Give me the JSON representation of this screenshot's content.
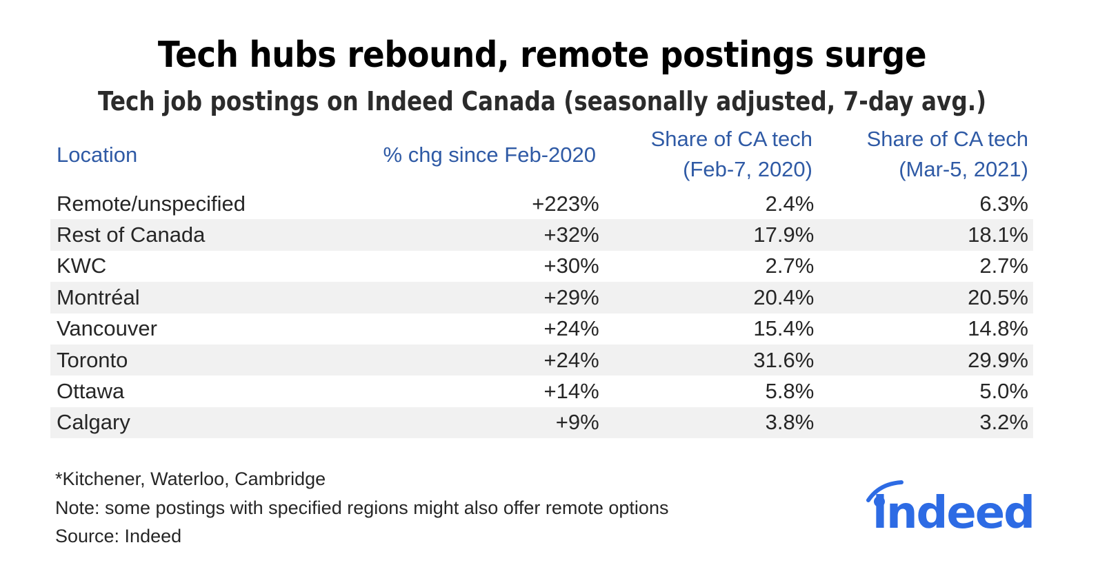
{
  "title": "Tech hubs rebound, remote postings surge",
  "subtitle": "Tech job postings on Indeed Canada (seasonally adjusted, 7-day avg.)",
  "colors": {
    "header_text": "#2f5aa5",
    "stripe": "#f1f1f1",
    "logo": "#2d6be4"
  },
  "chart_data": {
    "type": "table",
    "title": "Tech hubs rebound, remote postings surge",
    "subtitle": "Tech job postings on Indeed Canada (seasonally adjusted, 7-day avg.)",
    "columns": [
      "Location",
      "% chg since Feb-2020",
      "Share of CA tech (Feb-7, 2020)",
      "Share of CA tech (Mar-5, 2021)"
    ],
    "header": {
      "location": "Location",
      "pct_chg": "% chg since Feb-2020",
      "share_2020_line1": "Share of CA tech",
      "share_2020_line2": "(Feb-7, 2020)",
      "share_2021_line1": "Share of CA tech",
      "share_2021_line2": "(Mar-5, 2021)"
    },
    "rows": [
      {
        "location": "Remote/unspecified",
        "pct_chg": "+223%",
        "share_2020": "2.4%",
        "share_2021": "6.3%"
      },
      {
        "location": "Rest of Canada",
        "pct_chg": "+32%",
        "share_2020": "17.9%",
        "share_2021": "18.1%"
      },
      {
        "location": "KWC",
        "pct_chg": "+30%",
        "share_2020": "2.7%",
        "share_2021": "2.7%"
      },
      {
        "location": "Montréal",
        "pct_chg": "+29%",
        "share_2020": "20.4%",
        "share_2021": "20.5%"
      },
      {
        "location": "Vancouver",
        "pct_chg": "+24%",
        "share_2020": "15.4%",
        "share_2021": "14.8%"
      },
      {
        "location": "Toronto",
        "pct_chg": "+24%",
        "share_2020": "31.6%",
        "share_2021": "29.9%"
      },
      {
        "location": "Ottawa",
        "pct_chg": "+14%",
        "share_2020": "5.8%",
        "share_2021": "5.0%"
      },
      {
        "location": "Calgary",
        "pct_chg": "+9%",
        "share_2020": "3.8%",
        "share_2021": "3.2%"
      }
    ]
  },
  "footnotes": {
    "kwc": "*Kitchener, Waterloo, Cambridge",
    "note": "Note: some postings with specified regions might also offer remote options",
    "source": "Source: Indeed"
  },
  "logo": {
    "text": "indeed",
    "icon": "indeed-logo-icon"
  }
}
